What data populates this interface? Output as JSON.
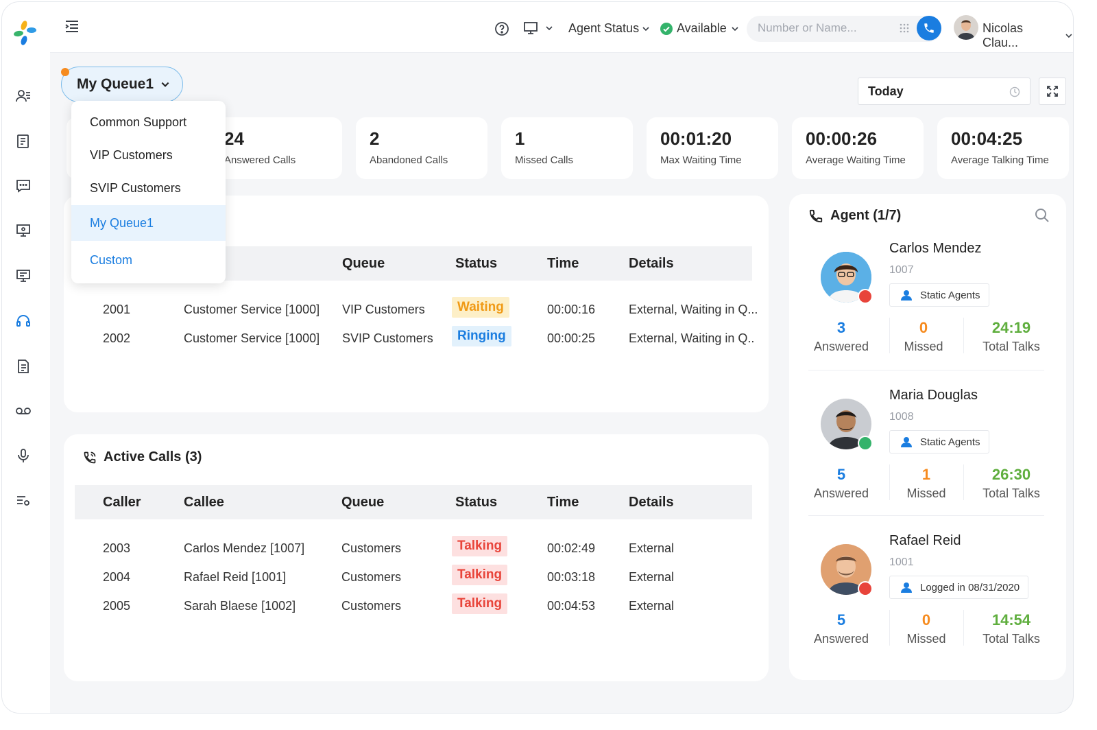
{
  "topbar": {
    "agent_status_label": "Agent Status",
    "available_label": "Available",
    "search_placeholder": "Number or Name...",
    "user_name": "Nicolas Clau..."
  },
  "queue_selector": {
    "label": "My Queue1"
  },
  "queue_menu": {
    "items": [
      "Common Support",
      "VIP Customers",
      "SVIP Customers",
      "My Queue1"
    ],
    "custom_label": "Custom",
    "selected": "My Queue1"
  },
  "date_filter": {
    "label": "Today"
  },
  "stats": [
    {
      "value": "24",
      "label": "Answered Calls"
    },
    {
      "value": "2",
      "label": "Abandoned Calls"
    },
    {
      "value": "1",
      "label": "Missed Calls"
    },
    {
      "value": "00:01:20",
      "label": "Max Waiting Time"
    },
    {
      "value": "00:00:26",
      "label": "Average Waiting Time"
    },
    {
      "value": "00:04:25",
      "label": "Average Talking Time"
    }
  ],
  "waiting": {
    "headers": {
      "queue": "Queue",
      "status": "Status",
      "time": "Time",
      "details": "Details"
    },
    "rows": [
      {
        "caller": "2001",
        "callee": "Customer Service [1000]",
        "queue": "VIP Customers",
        "status": "Waiting",
        "time": "00:00:16",
        "details": "External, Waiting in Q..."
      },
      {
        "caller": "2002",
        "callee": "Customer Service [1000]",
        "queue": "SVIP Customers",
        "status": "Ringing",
        "time": "00:00:25",
        "details": "External, Waiting in Q.."
      }
    ]
  },
  "active": {
    "title": "Active Calls (3)",
    "headers": {
      "caller": "Caller",
      "callee": "Callee",
      "queue": "Queue",
      "status": "Status",
      "time": "Time",
      "details": "Details"
    },
    "rows": [
      {
        "caller": "2003",
        "callee": "Carlos Mendez [1007]",
        "queue": "Customers",
        "status": "Talking",
        "time": "00:02:49",
        "details": "External"
      },
      {
        "caller": "2004",
        "callee": "Rafael Reid [1001]",
        "queue": "Customers",
        "status": "Talking",
        "time": "00:03:18",
        "details": "External"
      },
      {
        "caller": "2005",
        "callee": "Sarah Blaese [1002]",
        "queue": "Customers",
        "status": "Talking",
        "time": "00:04:53",
        "details": "External"
      }
    ]
  },
  "agents": {
    "title": "Agent (1/7)",
    "labels": {
      "answered": "Answered",
      "missed": "Missed",
      "total": "Total Talks"
    },
    "list": [
      {
        "name": "Carlos Mendez",
        "ext": "1007",
        "tag": "Static Agents",
        "answered": "3",
        "missed": "0",
        "total": "24:19",
        "presence": "busy"
      },
      {
        "name": "Maria Douglas",
        "ext": "1008",
        "tag": "Static Agents",
        "answered": "5",
        "missed": "1",
        "total": "26:30",
        "presence": "available"
      },
      {
        "name": "Rafael Reid",
        "ext": "1001",
        "tag": "Logged in 08/31/2020",
        "answered": "5",
        "missed": "0",
        "total": "14:54",
        "presence": "busy"
      }
    ]
  },
  "colors": {
    "accent": "#1a7de0",
    "waiting": "#f09a16",
    "talking": "#e8443a",
    "answered": "#1a7de0",
    "missed": "#f68b1f",
    "total": "#5fae3e",
    "available": "#34b36b",
    "busy": "#e8443a"
  },
  "sidebar_icons": [
    "contacts-icon",
    "phonebook-icon",
    "chat-icon",
    "monitor-icon",
    "dashboard-icon",
    "headset-icon",
    "report-icon",
    "voicemail-icon",
    "recording-icon",
    "settings-icon"
  ]
}
